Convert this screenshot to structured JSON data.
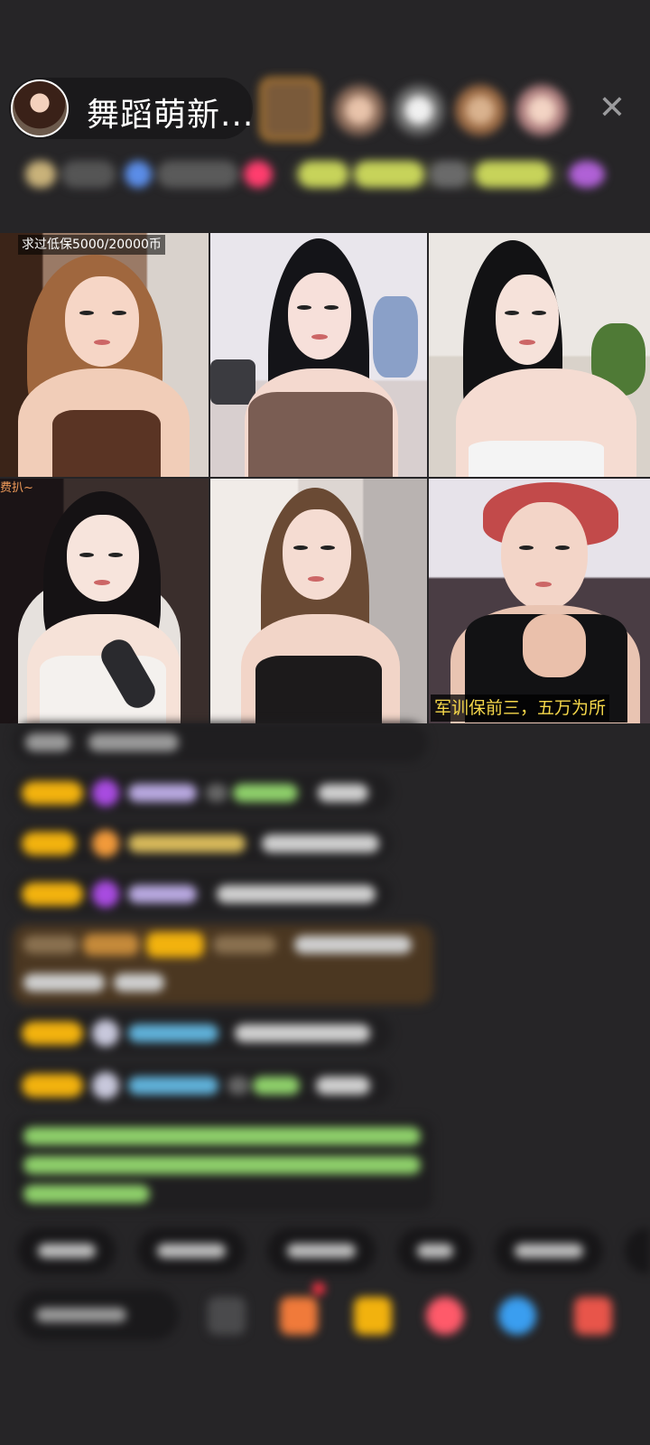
{
  "header": {
    "host_name": "舞蹈萌新..."
  },
  "grid": {
    "tile1_overlay": "求过低保5000/20000币",
    "tile4_overlay": "费扒~",
    "tile6_caption": "军训保前三，五万为所"
  },
  "colors": {
    "background": "#262527",
    "badge_gold": "#f2b20e",
    "caption_yellow": "#f6d84a",
    "chat_green": "#8ed06a",
    "highlight_brown": "#4b3721"
  }
}
